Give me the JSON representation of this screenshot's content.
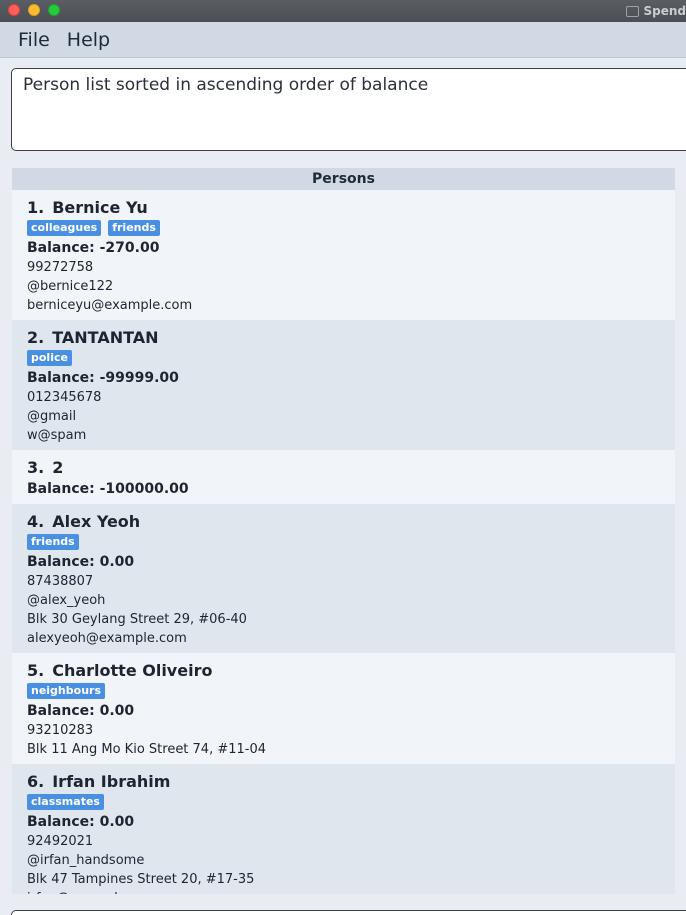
{
  "window": {
    "title": "Spend"
  },
  "menu": {
    "items": [
      "File",
      "Help"
    ]
  },
  "result": {
    "text": "Person list sorted in ascending order of balance"
  },
  "persons": {
    "header": "Persons",
    "list": [
      {
        "index": "1.",
        "name": "Bernice Yu",
        "tags": [
          "colleagues",
          "friends"
        ],
        "balance": "Balance: -270.00",
        "details": [
          "99272758",
          "@bernice122",
          "berniceyu@example.com"
        ]
      },
      {
        "index": "2.",
        "name": "TANTANTAN",
        "tags": [
          "police"
        ],
        "balance": "Balance: -99999.00",
        "details": [
          "012345678",
          "@gmail",
          "w@spam"
        ]
      },
      {
        "index": "3.",
        "name": "2",
        "tags": [],
        "balance": "Balance: -100000.00",
        "details": []
      },
      {
        "index": "4.",
        "name": "Alex Yeoh",
        "tags": [
          "friends"
        ],
        "balance": "Balance: 0.00",
        "details": [
          "87438807",
          "@alex_yeoh",
          "Blk 30 Geylang Street 29, #06-40",
          "alexyeoh@example.com"
        ]
      },
      {
        "index": "5.",
        "name": "Charlotte Oliveiro",
        "tags": [
          "neighbours"
        ],
        "balance": "Balance: 0.00",
        "details": [
          "93210283",
          "Blk 11 Ang Mo Kio Street 74, #11-04"
        ]
      },
      {
        "index": "6.",
        "name": "Irfan Ibrahim",
        "tags": [
          "classmates"
        ],
        "balance": "Balance: 0.00",
        "details": [
          "92492021",
          "@irfan_handsome",
          "Blk 47 Tampines Street 20, #17-35",
          "irfan@example.com"
        ]
      }
    ]
  },
  "colors": {
    "tag": "#4a90e2",
    "menubar": "#d0d9e4",
    "card_odd": "#f1f4f8",
    "card_even": "#e0e6ee"
  }
}
